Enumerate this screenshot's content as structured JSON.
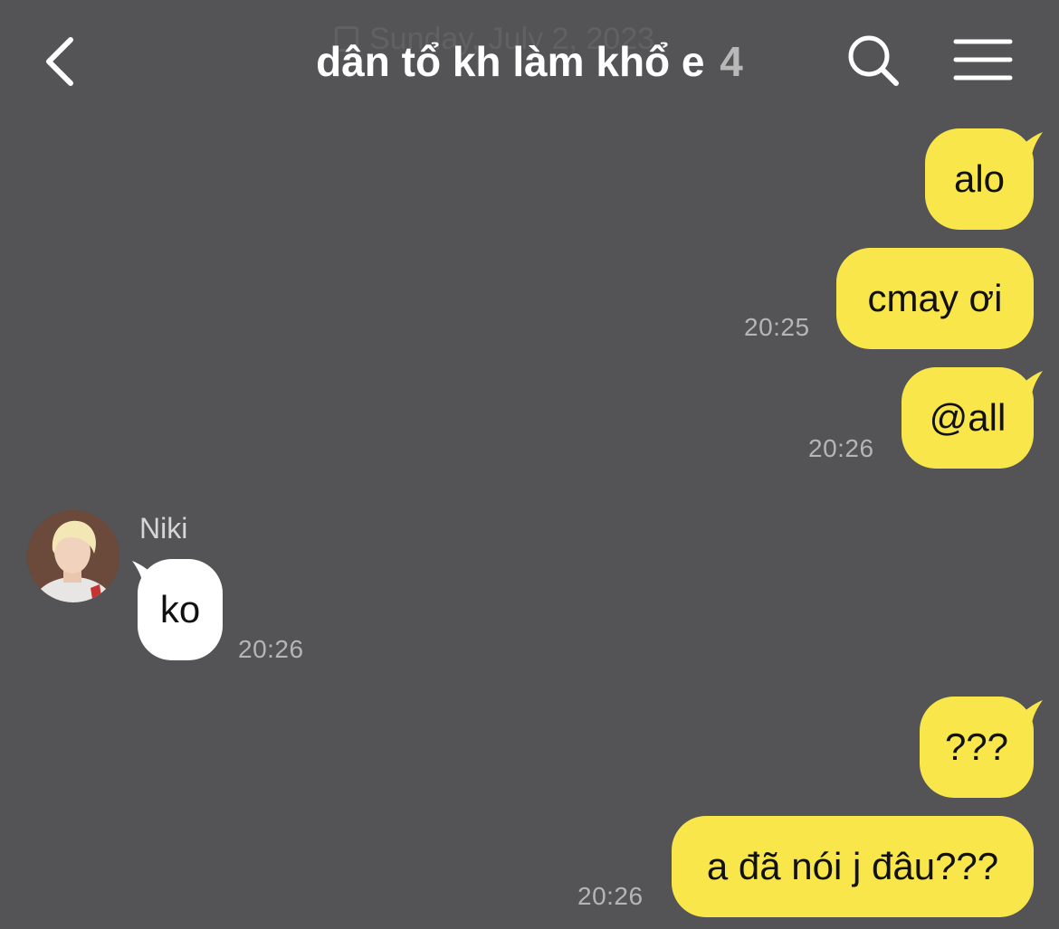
{
  "header": {
    "ghost_date": "Sunday, July 2, 2023",
    "title": "dân tổ kh làm khổ e",
    "member_count": "4"
  },
  "messages": [
    {
      "text": "alo",
      "direction": "out",
      "time": ""
    },
    {
      "text": "cmay ơi",
      "direction": "out",
      "time": "20:25"
    },
    {
      "text": "@all",
      "direction": "out",
      "time": "20:26"
    },
    {
      "sender": "Niki",
      "text": "ko",
      "direction": "in",
      "time": "20:26"
    },
    {
      "text": "???",
      "direction": "out",
      "time": ""
    },
    {
      "text": "a đã nói j đâu???",
      "direction": "out",
      "time": "20:26"
    }
  ],
  "colors": {
    "background": "#545355",
    "outgoing_bubble": "#f9e64b",
    "incoming_bubble": "#ffffff"
  },
  "icons": {
    "back": "chevron-left-icon",
    "search": "search-icon",
    "menu": "hamburger-menu-icon",
    "calendar": "calendar-icon"
  }
}
